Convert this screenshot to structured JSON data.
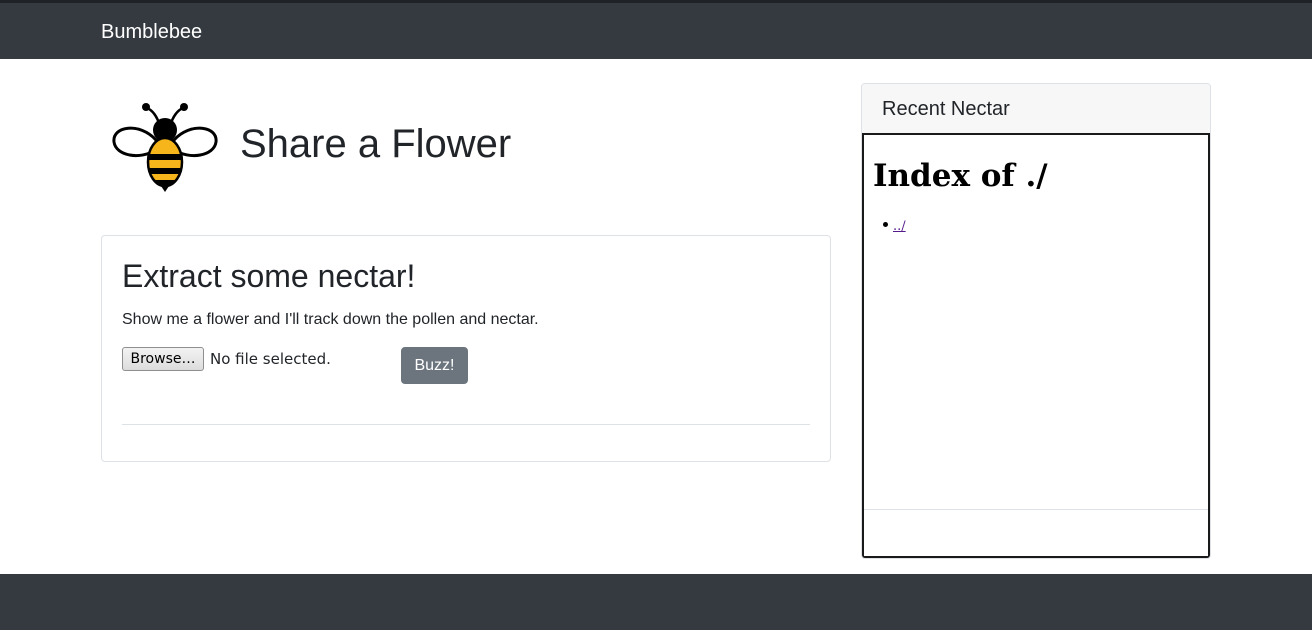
{
  "navbar": {
    "brand": "Bumblebee",
    "background": "#343a40"
  },
  "header": {
    "logo_icon": "bee-icon",
    "title": "Share a Flower"
  },
  "upload_card": {
    "title": "Extract some nectar!",
    "description": "Show me a flower and I'll track down the pollen and nectar.",
    "browse_label": "Browse…",
    "file_status": "No file selected.",
    "submit_label": "Buzz!",
    "submit_color": "#6c757d"
  },
  "sidebar": {
    "header": "Recent Nectar",
    "listing": {
      "heading": "Index of ./",
      "entries": [
        {
          "name": "../"
        }
      ]
    }
  },
  "footer": {
    "background": "#343a40"
  }
}
